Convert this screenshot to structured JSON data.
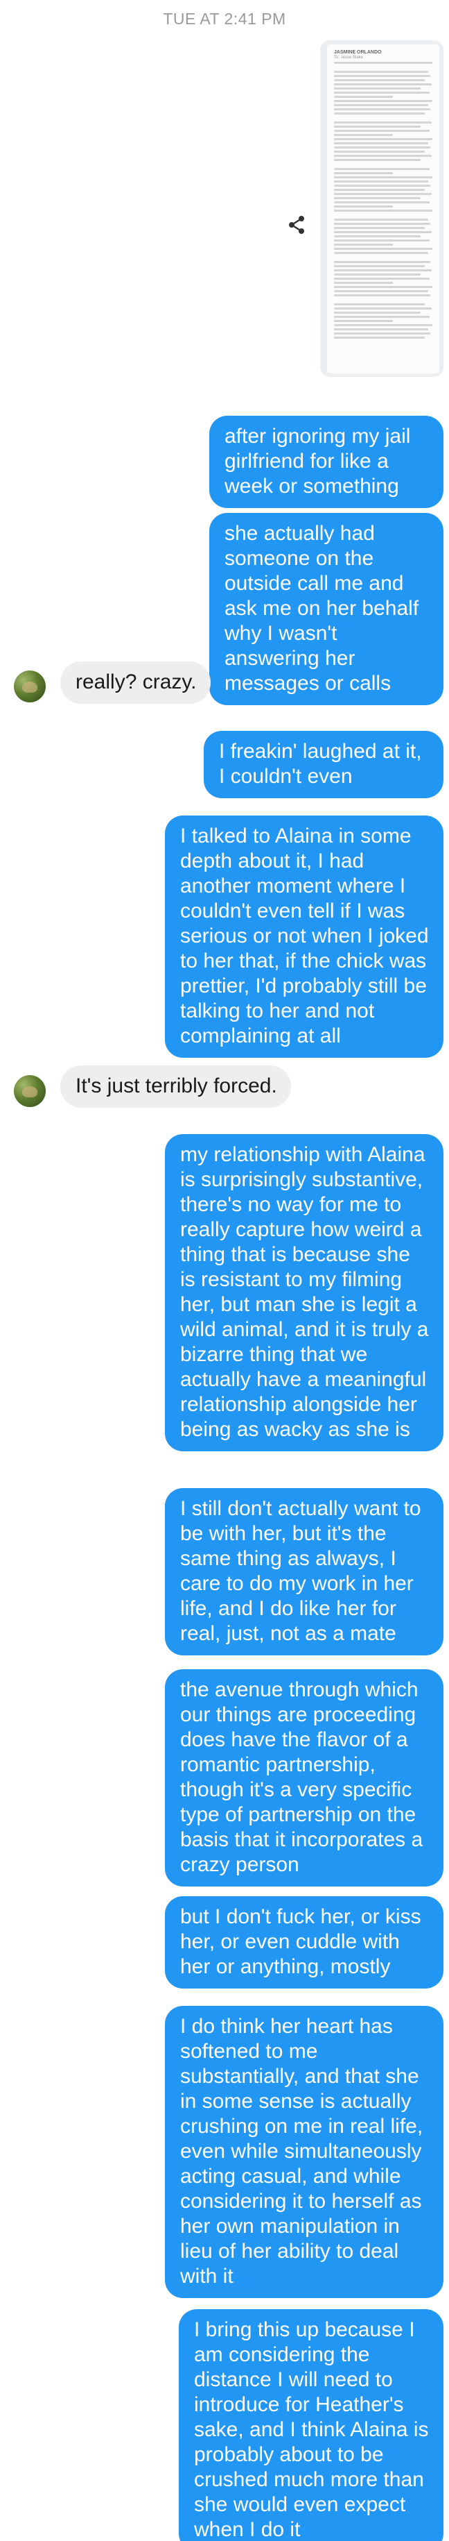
{
  "timestamp": "TUE AT 2:41 PM",
  "attachment": {
    "sender": "JASMINE ORLANDO",
    "recipient": "To: Jesse Blake",
    "body_lines": 60,
    "share_icon": "share-icon"
  },
  "messages": [
    {
      "side": "sent",
      "text": "after ignoring my jail girlfriend for like a week or something"
    },
    {
      "side": "sent",
      "text": "she actually had someone on the outside call me and ask me on her behalf why I wasn't answering her messages or calls"
    },
    {
      "side": "recv",
      "text": "really? crazy."
    },
    {
      "side": "sent",
      "text": "I freakin' laughed at it, I couldn't even"
    },
    {
      "side": "sent",
      "text": "I talked to Alaina in some depth about it, I had another moment where I couldn't even tell if I was serious or not when I joked to her that, if the chick was prettier, I'd probably still be talking to her and not complaining at all"
    },
    {
      "side": "recv",
      "text": "It's just terribly forced."
    },
    {
      "side": "sent",
      "text": "my relationship with Alaina is surprisingly substantive, there's no way for me to really capture how weird a thing that is because she is resistant to my filming her, but man she is legit a wild animal, and it is truly a bizarre thing that we actually have a meaningful relationship alongside her being as wacky as she is"
    },
    {
      "side": "sent",
      "text": "I still don't actually want to be with her, but it's the same thing as always, I care to do my work in her life, and I do like her for real, just, not as a mate"
    },
    {
      "side": "sent",
      "text": "the avenue through which our things are proceeding does have the flavor of a romantic partnership, though it's a very specific type of partnership on the basis that it incorporates a crazy person"
    },
    {
      "side": "sent",
      "text": "but I don't fuck her, or kiss her, or even cuddle with her or anything, mostly"
    },
    {
      "side": "sent",
      "text": "I do think her heart has softened to me substantially, and that she in some sense is actually crushing on me in real life, even while simultaneously acting casual, and while considering it to herself as her own manipulation in lieu of her ability to deal with it"
    },
    {
      "side": "sent",
      "text": "I bring this up because I am considering the distance I will need to introduce for Heather's sake, and I think Alaina is probably about to be crushed much more than she would even expect when I do it"
    }
  ],
  "colors": {
    "sent_bubble": "#2196f3",
    "recv_bubble": "#eeeeee",
    "timestamp": "#9a9a9a"
  }
}
